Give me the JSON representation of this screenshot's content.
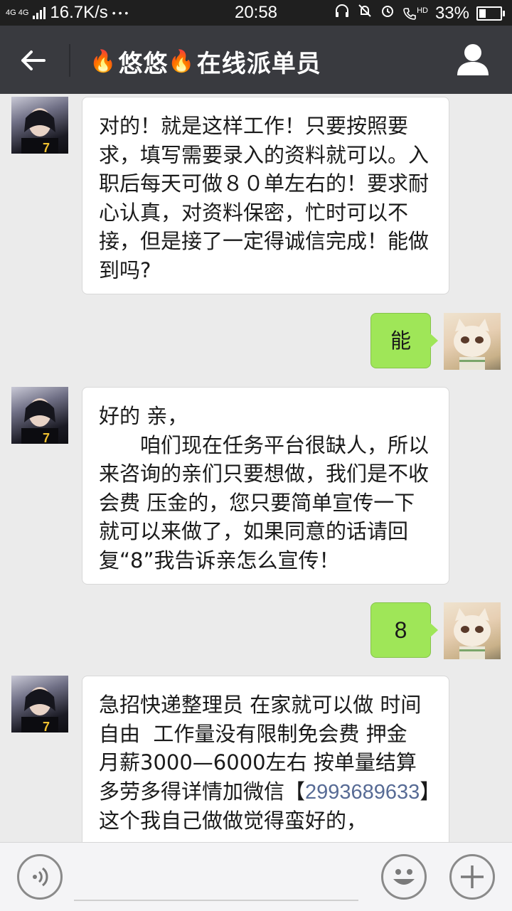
{
  "status_bar": {
    "network_type": "4G 4G",
    "speed": "16.7K/s",
    "dots": "• • •",
    "time": "20:58",
    "hd_label": "HD",
    "battery": "33%"
  },
  "header": {
    "fire_emoji": "🔥",
    "name_part1": "悠悠",
    "name_part2": "在线派单员",
    "back_icon": "arrow-left",
    "profile_icon": "person"
  },
  "messages": [
    {
      "side": "left",
      "text": "对的！就是这样工作！只要按照要求，填写需要录入的资料就可以。入职后每天可做８０单左右的！要求耐心认真，对资料保密，忙时可以不接，但是接了一定得诚信完成！能做到吗?"
    },
    {
      "side": "right",
      "text": "能"
    },
    {
      "side": "left",
      "text_line1": "好的 亲，",
      "text_rest": "咱们现在任务平台很缺人，所以来咨询的亲们只要想做，我们是不收会费 压金的，您只要简单宣传一下就可以来做了，如果同意的话请回复“8”我告诉亲怎么宣传！"
    },
    {
      "side": "right",
      "text": "8"
    },
    {
      "side": "left",
      "text_before": "急招快递整理员 在家就可以做 时间自由  工作量没有限制免会费 押金  月薪3000—6000左右 按单量结算 多劳多得详情加微信【",
      "number": "2993689633",
      "text_after": "】这个我自己做做觉得蛮好的，"
    }
  ],
  "colors": {
    "header_bg": "#393a3f",
    "sent_bubble": "#9fe658",
    "received_bubble": "#ffffff",
    "link": "#576b95",
    "chat_bg": "#ebebeb"
  },
  "bottom_bar": {
    "voice_icon": "voice",
    "emoji_icon": "smile",
    "plus_icon": "plus"
  }
}
